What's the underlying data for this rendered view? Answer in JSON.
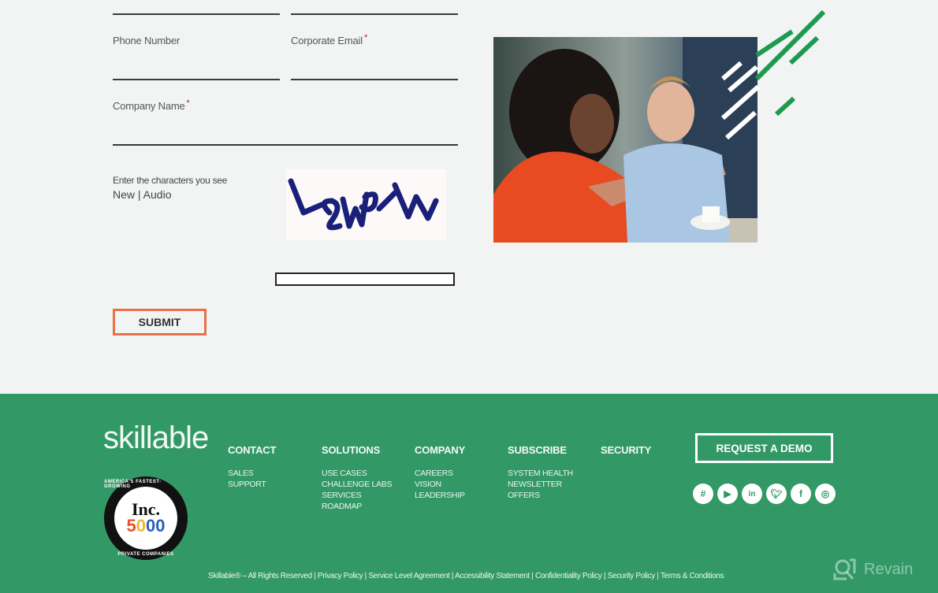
{
  "form": {
    "phone_label": "Phone Number",
    "email_label": "Corporate Email",
    "company_label": "Company Name",
    "required_mark": "*",
    "phone_value": "",
    "email_value": "",
    "company_value": "",
    "captcha": {
      "hint": "Enter the characters you see",
      "new_link": "New",
      "separator": " | ",
      "audio_link": "Audio",
      "image_text": "VSWPHW",
      "input_value": ""
    },
    "submit_label": "SUBMIT"
  },
  "photo": {
    "alt": "Two colleagues discussing at a cafe table"
  },
  "footer": {
    "logo": "skillable",
    "badge": {
      "top_text": "AMERICA'S FASTEST-GROWING",
      "title": "Inc.",
      "number": "5000",
      "bottom_text": "PRIVATE COMPANIES"
    },
    "columns": [
      {
        "heading": "CONTACT",
        "links": [
          "SALES",
          "SUPPORT"
        ]
      },
      {
        "heading": "SOLUTIONS",
        "links": [
          "USE CASES",
          "CHALLENGE LABS",
          "SERVICES",
          "ROADMAP"
        ]
      },
      {
        "heading": "COMPANY",
        "links": [
          "CAREERS",
          "VISION",
          "LEADERSHIP"
        ]
      },
      {
        "heading": "SUBSCRIBE",
        "links": [
          "SYSTEM HEALTH",
          "NEWSLETTER",
          "OFFERS"
        ]
      },
      {
        "heading": "SECURITY",
        "links": []
      }
    ],
    "demo_label": "REQUEST A DEMO",
    "socials": [
      "slack",
      "youtube",
      "linkedin",
      "twitter",
      "facebook",
      "instagram"
    ],
    "legal": {
      "copyright": "Skillable® – All Rights Reserved",
      "links": [
        "Privacy Policy",
        "Service Level Agreement",
        "Accessibility Statement",
        "Confidentiality Policy",
        "Security Policy",
        "Terms & Conditions"
      ]
    },
    "watermark": "Revain"
  },
  "colors": {
    "footer_bg": "#329966",
    "submit_border": "#e8704a",
    "required": "#c8102e",
    "page_bg": "#f2f4f3"
  }
}
